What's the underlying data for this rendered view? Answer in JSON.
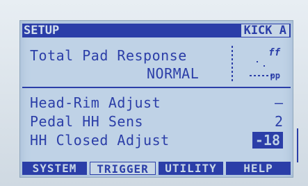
{
  "header": {
    "left": "SETUP",
    "right": "KICK A"
  },
  "total_pad": {
    "label": "Total Pad Response",
    "value": "NORMAL",
    "curve_top": "ff",
    "curve_bottom": "pp"
  },
  "params": [
    {
      "label": "Head-Rim Adjust",
      "value": "—"
    },
    {
      "label": "Pedal HH Sens",
      "value": "2"
    },
    {
      "label": "HH Closed Adjust",
      "value": "-18"
    }
  ],
  "tabs": [
    {
      "label": "SYSTEM"
    },
    {
      "label": "TRIGGER"
    },
    {
      "label": "UTILITY"
    },
    {
      "label": "HELP"
    }
  ]
}
